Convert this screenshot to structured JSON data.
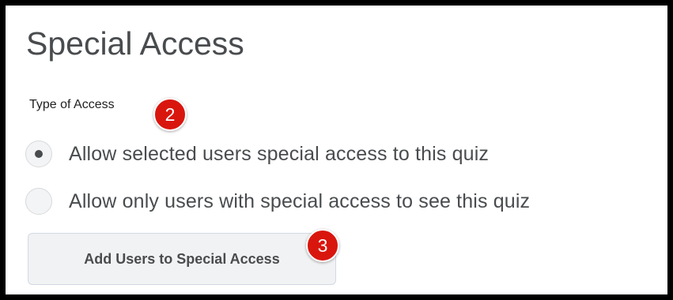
{
  "page": {
    "title": "Special Access",
    "type_of_access_label": "Type of Access"
  },
  "access_options": [
    {
      "label": "Allow selected users special access to this quiz",
      "selected": true
    },
    {
      "label": "Allow only users with special access to see this quiz",
      "selected": false
    }
  ],
  "add_button": {
    "label": "Add Users to Special Access"
  },
  "annotations": {
    "step_two": "2",
    "step_three": "3"
  },
  "colors": {
    "text": "#494c4e",
    "frame": "#000000",
    "badge": "#d9160e",
    "button_bg": "#f1f2f3"
  }
}
